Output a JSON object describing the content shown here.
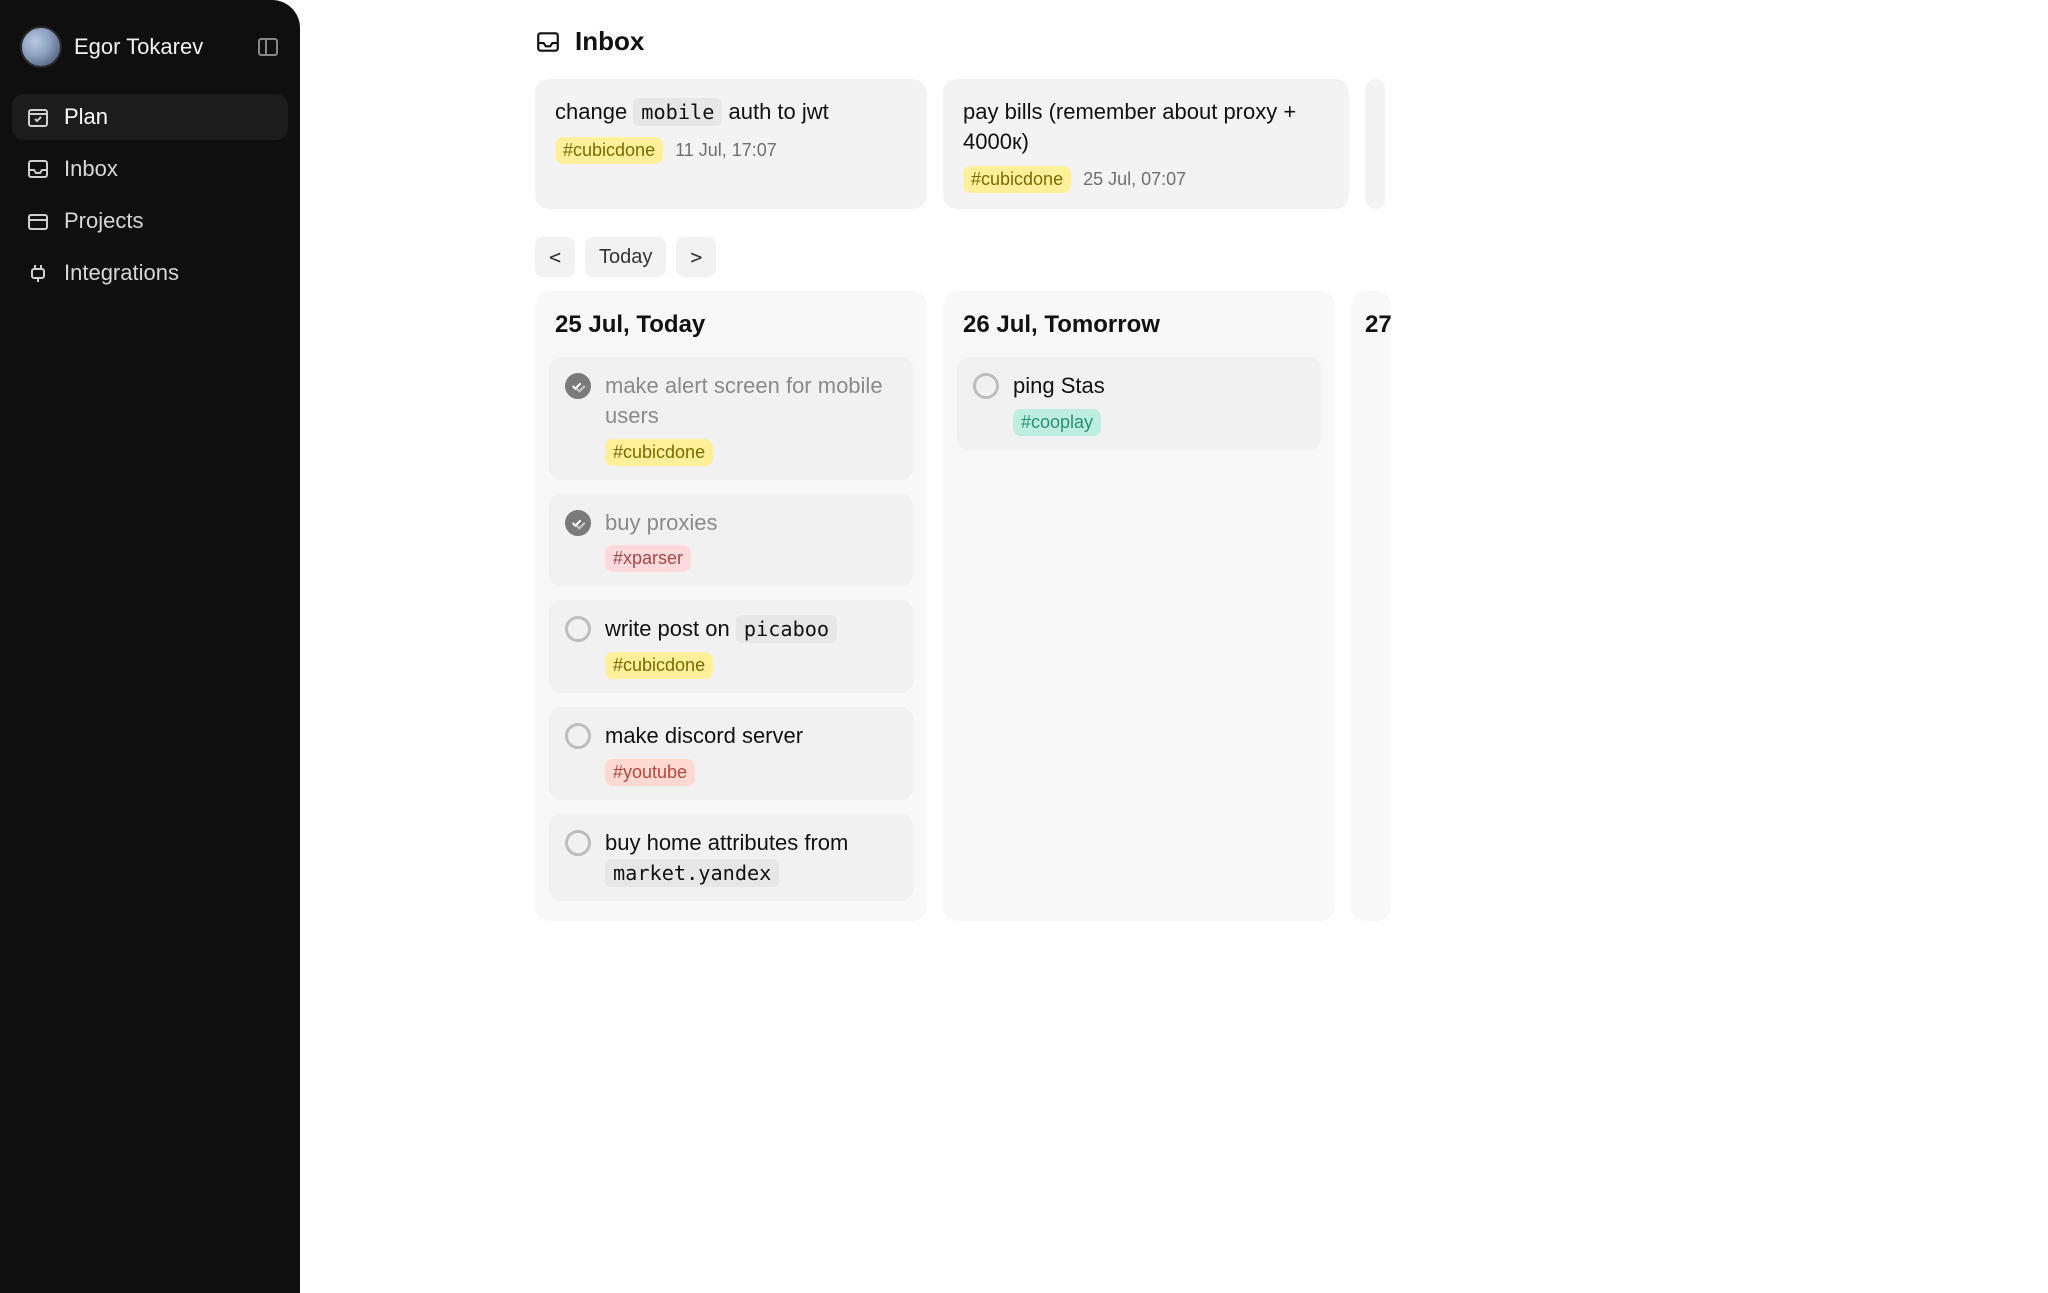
{
  "user": {
    "name": "Egor Tokarev"
  },
  "nav": {
    "plan": "Plan",
    "inbox": "Inbox",
    "projects": "Projects",
    "integrations": "Integrations"
  },
  "section": {
    "title": "Inbox"
  },
  "inbox_cards": [
    {
      "title_prefix": "change ",
      "title_code": "mobile",
      "title_suffix": " auth to jwt",
      "tag": "#cubicdone",
      "tag_class": "tag-yellow",
      "time": "11 Jul, 17:07"
    },
    {
      "title_prefix": "pay bills (remember about proxy + 4000к)",
      "title_code": "",
      "title_suffix": "",
      "tag": "#cubicdone",
      "tag_class": "tag-yellow",
      "time": "25 Jul, 07:07"
    }
  ],
  "daynav": {
    "prev": "<",
    "today": "Today",
    "next": ">"
  },
  "days": [
    {
      "heading": "25 Jul, Today",
      "tasks": [
        {
          "done": true,
          "title_prefix": "make alert screen for mobile users",
          "title_code": "",
          "title_suffix": "",
          "tag": "#cubicdone",
          "tag_class": "tag-yellow"
        },
        {
          "done": true,
          "title_prefix": "buy proxies",
          "title_code": "",
          "title_suffix": "",
          "tag": "#xparser",
          "tag_class": "tag-pink"
        },
        {
          "done": false,
          "title_prefix": "write post on ",
          "title_code": "picaboo",
          "title_suffix": "",
          "tag": "#cubicdone",
          "tag_class": "tag-yellow"
        },
        {
          "done": false,
          "title_prefix": "make discord server",
          "title_code": "",
          "title_suffix": "",
          "tag": "#youtube",
          "tag_class": "tag-red"
        },
        {
          "done": false,
          "title_prefix": "buy home attributes from ",
          "title_code": "market.yandex",
          "title_suffix": "",
          "tag": "",
          "tag_class": ""
        }
      ]
    },
    {
      "heading": "26 Jul, Tomorrow",
      "tasks": [
        {
          "done": false,
          "title_prefix": "ping Stas",
          "title_code": "",
          "title_suffix": "",
          "tag": "#cooplay",
          "tag_class": "tag-teal"
        }
      ]
    },
    {
      "heading": "27",
      "tasks": []
    }
  ]
}
